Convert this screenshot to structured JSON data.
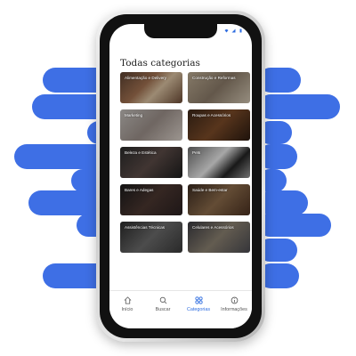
{
  "screen": {
    "title": "Todas categorias"
  },
  "categories": [
    {
      "label": "Alimentação e Delivery"
    },
    {
      "label": "Construção e Reformas"
    },
    {
      "label": "Marketing"
    },
    {
      "label": "Roupas e Acessórios"
    },
    {
      "label": "Beleza e Estética"
    },
    {
      "label": "Pets"
    },
    {
      "label": "Bares e Adegas"
    },
    {
      "label": "Saúde e Bem-estar"
    },
    {
      "label": "Assistências Técnicas"
    },
    {
      "label": "Celulares e Acessórios"
    }
  ],
  "tabs": [
    {
      "label": "Início",
      "icon": "home-icon"
    },
    {
      "label": "Buscar",
      "icon": "search-icon"
    },
    {
      "label": "Categorias",
      "icon": "grid-icon",
      "active": true
    },
    {
      "label": "Informações",
      "icon": "info-icon"
    }
  ],
  "colors": {
    "accent": "#2d6ce0",
    "stripes": "#3e6fe5"
  }
}
